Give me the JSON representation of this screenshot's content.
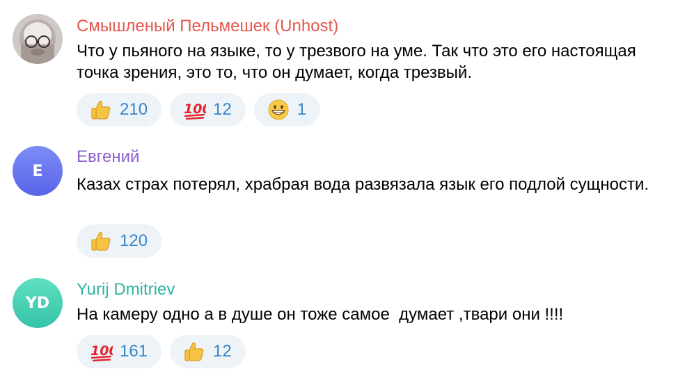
{
  "comments": [
    {
      "author": "Смышленый Пельмешек (Unhost)",
      "author_color": "#e4574b",
      "avatar_type": "photo",
      "text": "Что у пьяного на языке, то у трезвого на уме. Так что это его настоящая точка зрения, это то, что он думает, когда трезвый.",
      "reactions": [
        {
          "icon": "thumbs-up-icon",
          "count": "210"
        },
        {
          "icon": "hundred-points-icon",
          "count": "12"
        },
        {
          "icon": "grinning-face-icon",
          "count": "1"
        }
      ]
    },
    {
      "author": "Евгений",
      "author_color": "#8e62cf",
      "avatar_type": "initials",
      "avatar_initials": "Е",
      "avatar_colors": [
        "#7d8cf7",
        "#5a64e8"
      ],
      "text": "Казах страх потерял, храбрая вода развязала язык его подлой сущности.",
      "reactions": [
        {
          "icon": "thumbs-up-icon",
          "count": "120"
        }
      ]
    },
    {
      "author": "Yurij Dmitriev",
      "author_color": "#2bb5a2",
      "avatar_type": "initials",
      "avatar_initials": "YD",
      "avatar_colors": [
        "#5fe0c0",
        "#35c3a8"
      ],
      "text": "На камеру одно а в душе он тоже самое  думает ,твари они !!!!",
      "reactions": [
        {
          "icon": "hundred-points-icon",
          "count": "161"
        },
        {
          "icon": "thumbs-up-icon",
          "count": "12"
        }
      ]
    }
  ]
}
